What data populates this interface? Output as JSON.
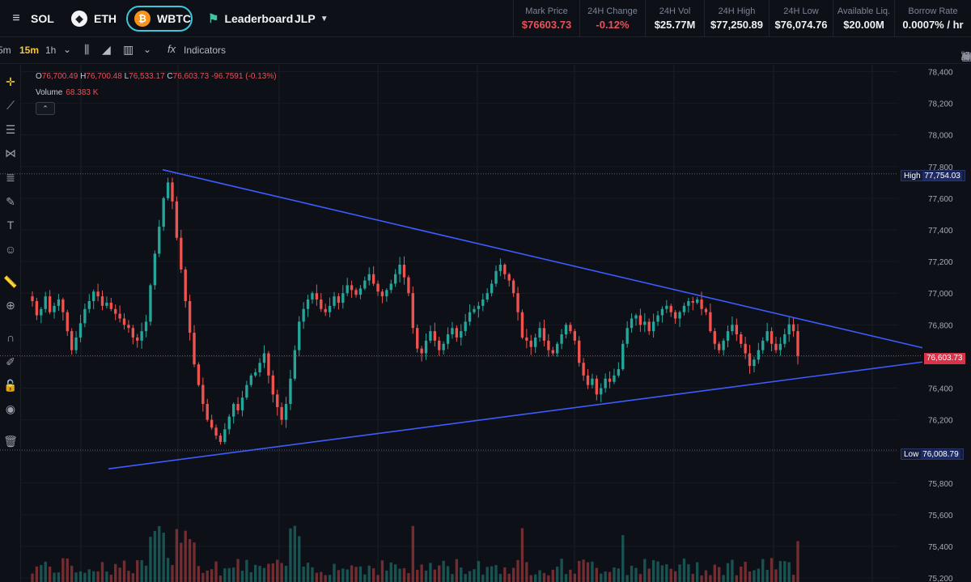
{
  "header": {
    "tokens": [
      {
        "label": "SOL",
        "icon": "solana-icon"
      },
      {
        "label": "ETH",
        "icon": "ethereum-icon"
      },
      {
        "label": "WBTC",
        "icon": "bitcoin-icon"
      }
    ],
    "leaderboard": "Leaderboard",
    "jlp": "JLP",
    "stats": [
      {
        "label": "Mark Price",
        "value": "$76603.73"
      },
      {
        "label": "24H Change",
        "value": "-0.12%"
      },
      {
        "label": "24H Vol",
        "value": "$25.77M"
      },
      {
        "label": "24H High",
        "value": "$77,250.89"
      },
      {
        "label": "24H Low",
        "value": "$76,074.76"
      },
      {
        "label": "Available Liq.",
        "value": "$20.00M"
      },
      {
        "label": "Borrow Rate",
        "value": "0.0007% / hr"
      }
    ],
    "accent_colors": {
      "active_pair_border": "#3ec6d9",
      "negative": "#e8525b",
      "positive": "#26a69a"
    }
  },
  "toolbar": {
    "timeframes": [
      "5m",
      "15m",
      "1h"
    ],
    "active_timeframe": "15m",
    "indicators_label": "Indicators"
  },
  "legend": {
    "o_label": "O",
    "o_value": "76,700.49",
    "h_label": "H",
    "h_value": "76,700.48",
    "l_label": "L",
    "l_value": "76,533.17",
    "c_label": "C",
    "c_value": "76,603.73",
    "change": "-96.7591 (-0.13%)",
    "volume_label": "Volume",
    "volume_value": "68.383 K"
  },
  "price_axis": {
    "ticks": [
      "78,400",
      "78,200",
      "78,000",
      "77,800",
      "77,600",
      "77,400",
      "77,200",
      "77,000",
      "76,800",
      "76,600",
      "76,400",
      "76,200",
      "76,000",
      "75,800",
      "75,600",
      "75,400",
      "75,200"
    ],
    "high_label": "High",
    "high_value": "77,754.03",
    "low_label": "Low",
    "low_value": "76,008.79",
    "last_value": "76,603.73"
  },
  "chart_data": {
    "type": "candlestick",
    "ylim": [
      75200,
      78400
    ],
    "high": 77754.03,
    "low": 76008.79,
    "last": 76603.73,
    "volume_last": 68.383,
    "trendlines": [
      {
        "name": "resistance",
        "from": {
          "bar": 0,
          "price": 77780
        },
        "to": {
          "bar": 1,
          "price": 76655
        }
      },
      {
        "name": "support",
        "from": {
          "bar": 0,
          "price": 75890
        },
        "to": {
          "bar": 1,
          "price": 76565
        }
      }
    ],
    "closes": [
      76950,
      76860,
      76900,
      76980,
      76880,
      76920,
      76960,
      76880,
      76760,
      76640,
      76720,
      76810,
      76900,
      76950,
      77010,
      76980,
      76920,
      76940,
      76900,
      76870,
      76840,
      76800,
      76780,
      76720,
      76700,
      76760,
      76820,
      77050,
      77250,
      77420,
      77600,
      77700,
      77580,
      77350,
      77150,
      76950,
      76750,
      76550,
      76420,
      76300,
      76200,
      76150,
      76100,
      76060,
      76140,
      76220,
      76300,
      76260,
      76340,
      76420,
      76480,
      76500,
      76560,
      76620,
      76480,
      76360,
      76280,
      76200,
      76300,
      76460,
      76640,
      76820,
      76900,
      76960,
      77000,
      76960,
      76900,
      76880,
      76920,
      76980,
      76940,
      77000,
      77050,
      77020,
      76990,
      77030,
      77080,
      77120,
      77060,
      77010,
      76980,
      77020,
      77060,
      77120,
      77180,
      77100,
      77000,
      76780,
      76650,
      76620,
      76700,
      76760,
      76700,
      76640,
      76680,
      76740,
      76780,
      76720,
      76760,
      76820,
      76880,
      76900,
      76920,
      76960,
      77000,
      77060,
      77140,
      77180,
      77120,
      77080,
      77000,
      76880,
      76720,
      76700,
      76660,
      76720,
      76780,
      76700,
      76640,
      76620,
      76680,
      76740,
      76800,
      76760,
      76700,
      76560,
      76480,
      76420,
      76460,
      76360,
      76400,
      76460,
      76440,
      76480,
      76520,
      76680,
      76780,
      76840,
      76860,
      76800,
      76820,
      76760,
      76820,
      76860,
      76900,
      76920,
      76880,
      76840,
      76880,
      76920,
      76950,
      76940,
      76960,
      76900,
      76880,
      76760,
      76680,
      76640,
      76700,
      76760,
      76800,
      76740,
      76680,
      76620,
      76540,
      76580,
      76640,
      76700,
      76760,
      76680,
      76640,
      76680,
      76740,
      76803,
      76760,
      76604
    ]
  }
}
